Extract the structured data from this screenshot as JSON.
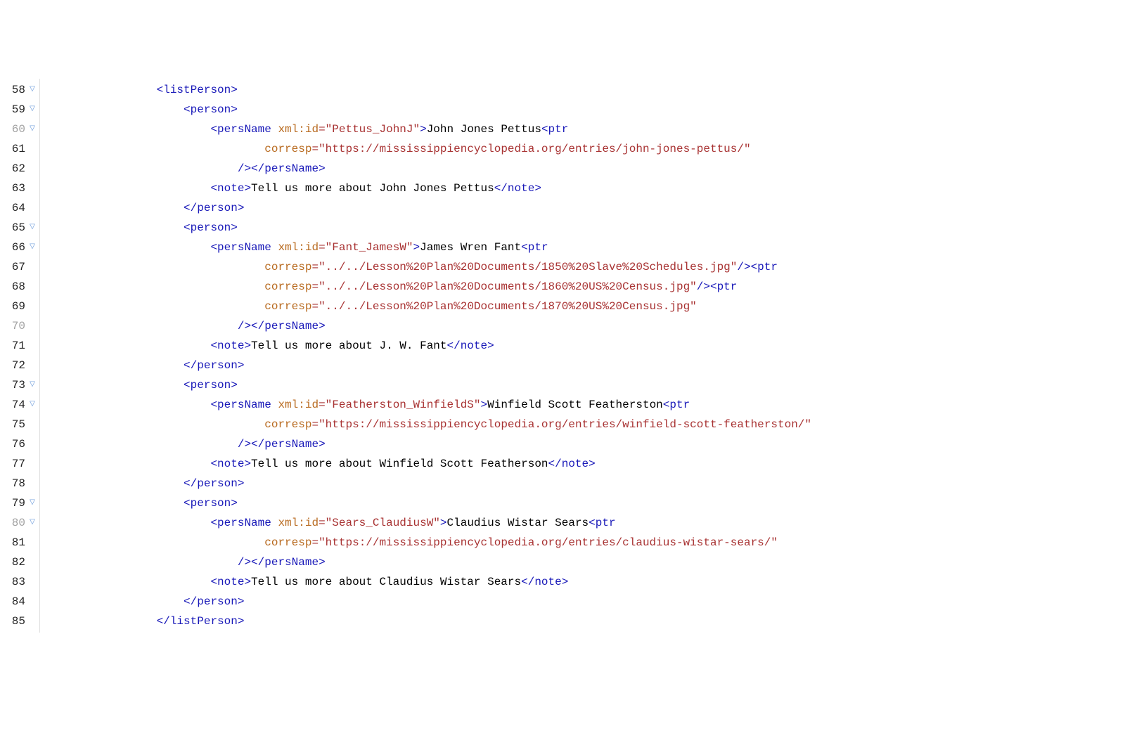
{
  "lines": [
    {
      "num": 58,
      "shade": "dark",
      "fold": true,
      "indent": 16,
      "tokens": [
        [
          "tag",
          "<listPerson>"
        ]
      ]
    },
    {
      "num": 59,
      "shade": "dark",
      "fold": true,
      "indent": 20,
      "tokens": [
        [
          "tag",
          "<person>"
        ]
      ]
    },
    {
      "num": 60,
      "shade": "light",
      "fold": true,
      "indent": 24,
      "tokens": [
        [
          "tag",
          "<persName "
        ],
        [
          "attr",
          "xml:id"
        ],
        [
          "eq",
          "="
        ],
        [
          "val",
          "\"Pettus_JohnJ\""
        ],
        [
          "tag",
          ">"
        ],
        [
          "text",
          "John Jones Pettus"
        ],
        [
          "tag",
          "<ptr"
        ]
      ]
    },
    {
      "num": 61,
      "shade": "dark",
      "fold": false,
      "indent": 32,
      "tokens": [
        [
          "attr",
          "corresp"
        ],
        [
          "eq",
          "="
        ],
        [
          "val",
          "\"https://mississippiencyclopedia.org/entries/john-jones-pettus/\""
        ]
      ]
    },
    {
      "num": 62,
      "shade": "dark",
      "fold": false,
      "indent": 28,
      "tokens": [
        [
          "tag",
          "/></persName>"
        ]
      ]
    },
    {
      "num": 63,
      "shade": "dark",
      "fold": false,
      "indent": 24,
      "tokens": [
        [
          "tag",
          "<note>"
        ],
        [
          "text",
          "Tell us more about John Jones Pettus"
        ],
        [
          "tag",
          "</note>"
        ]
      ]
    },
    {
      "num": 64,
      "shade": "dark",
      "fold": false,
      "indent": 20,
      "tokens": [
        [
          "tag",
          "</person>"
        ]
      ]
    },
    {
      "num": 65,
      "shade": "dark",
      "fold": true,
      "indent": 20,
      "tokens": [
        [
          "tag",
          "<person>"
        ]
      ]
    },
    {
      "num": 66,
      "shade": "dark",
      "fold": true,
      "indent": 24,
      "tokens": [
        [
          "tag",
          "<persName "
        ],
        [
          "attr",
          "xml:id"
        ],
        [
          "eq",
          "="
        ],
        [
          "val",
          "\"Fant_JamesW\""
        ],
        [
          "tag",
          ">"
        ],
        [
          "text",
          "James Wren Fant"
        ],
        [
          "tag",
          "<ptr"
        ]
      ]
    },
    {
      "num": 67,
      "shade": "dark",
      "fold": false,
      "indent": 32,
      "tokens": [
        [
          "attr",
          "corresp"
        ],
        [
          "eq",
          "="
        ],
        [
          "val",
          "\"../../Lesson%20Plan%20Documents/1850%20Slave%20Schedules.jpg\""
        ],
        [
          "tag",
          "/><ptr"
        ]
      ]
    },
    {
      "num": 68,
      "shade": "dark",
      "fold": false,
      "indent": 32,
      "tokens": [
        [
          "attr",
          "corresp"
        ],
        [
          "eq",
          "="
        ],
        [
          "val",
          "\"../../Lesson%20Plan%20Documents/1860%20US%20Census.jpg\""
        ],
        [
          "tag",
          "/><ptr"
        ]
      ]
    },
    {
      "num": 69,
      "shade": "dark",
      "fold": false,
      "indent": 32,
      "tokens": [
        [
          "attr",
          "corresp"
        ],
        [
          "eq",
          "="
        ],
        [
          "val",
          "\"../../Lesson%20Plan%20Documents/1870%20US%20Census.jpg\""
        ]
      ]
    },
    {
      "num": 70,
      "shade": "light",
      "fold": false,
      "indent": 28,
      "tokens": [
        [
          "tag",
          "/></persName>"
        ]
      ]
    },
    {
      "num": 71,
      "shade": "dark",
      "fold": false,
      "indent": 24,
      "tokens": [
        [
          "tag",
          "<note>"
        ],
        [
          "text",
          "Tell us more about J. W. Fant"
        ],
        [
          "tag",
          "</note>"
        ]
      ]
    },
    {
      "num": 72,
      "shade": "dark",
      "fold": false,
      "indent": 20,
      "tokens": [
        [
          "tag",
          "</person>"
        ]
      ]
    },
    {
      "num": 73,
      "shade": "dark",
      "fold": true,
      "indent": 20,
      "tokens": [
        [
          "tag",
          "<person>"
        ]
      ]
    },
    {
      "num": 74,
      "shade": "dark",
      "fold": true,
      "indent": 24,
      "tokens": [
        [
          "tag",
          "<persName "
        ],
        [
          "attr",
          "xml:id"
        ],
        [
          "eq",
          "="
        ],
        [
          "val",
          "\"Featherston_WinfieldS\""
        ],
        [
          "tag",
          ">"
        ],
        [
          "text",
          "Winfield Scott Featherston"
        ],
        [
          "tag",
          "<ptr"
        ]
      ]
    },
    {
      "num": 75,
      "shade": "dark",
      "fold": false,
      "indent": 32,
      "tokens": [
        [
          "attr",
          "corresp"
        ],
        [
          "eq",
          "="
        ],
        [
          "val",
          "\"https://mississippiencyclopedia.org/entries/winfield-scott-featherston/\""
        ]
      ]
    },
    {
      "num": 76,
      "shade": "dark",
      "fold": false,
      "indent": 28,
      "tokens": [
        [
          "tag",
          "/></persName>"
        ]
      ]
    },
    {
      "num": 77,
      "shade": "dark",
      "fold": false,
      "indent": 24,
      "tokens": [
        [
          "tag",
          "<note>"
        ],
        [
          "text",
          "Tell us more about Winfield Scott Featherson"
        ],
        [
          "tag",
          "</note>"
        ]
      ]
    },
    {
      "num": 78,
      "shade": "dark",
      "fold": false,
      "indent": 20,
      "tokens": [
        [
          "tag",
          "</person>"
        ]
      ]
    },
    {
      "num": 79,
      "shade": "dark",
      "fold": true,
      "indent": 20,
      "tokens": [
        [
          "tag",
          "<person>"
        ]
      ]
    },
    {
      "num": 80,
      "shade": "light",
      "fold": true,
      "indent": 24,
      "tokens": [
        [
          "tag",
          "<persName "
        ],
        [
          "attr",
          "xml:id"
        ],
        [
          "eq",
          "="
        ],
        [
          "val",
          "\"Sears_ClaudiusW\""
        ],
        [
          "tag",
          ">"
        ],
        [
          "text",
          "Claudius Wistar Sears"
        ],
        [
          "tag",
          "<ptr"
        ]
      ]
    },
    {
      "num": 81,
      "shade": "dark",
      "fold": false,
      "indent": 32,
      "tokens": [
        [
          "attr",
          "corresp"
        ],
        [
          "eq",
          "="
        ],
        [
          "val",
          "\"https://mississippiencyclopedia.org/entries/claudius-wistar-sears/\""
        ]
      ]
    },
    {
      "num": 82,
      "shade": "dark",
      "fold": false,
      "indent": 28,
      "tokens": [
        [
          "tag",
          "/></persName>"
        ]
      ]
    },
    {
      "num": 83,
      "shade": "dark",
      "fold": false,
      "indent": 24,
      "tokens": [
        [
          "tag",
          "<note>"
        ],
        [
          "text",
          "Tell us more about Claudius Wistar Sears"
        ],
        [
          "tag",
          "</note>"
        ]
      ]
    },
    {
      "num": 84,
      "shade": "dark",
      "fold": false,
      "indent": 20,
      "tokens": [
        [
          "tag",
          "</person>"
        ]
      ]
    },
    {
      "num": 85,
      "shade": "dark",
      "fold": false,
      "indent": 16,
      "tokens": [
        [
          "tag",
          "</listPerson>"
        ]
      ]
    }
  ],
  "fold_glyph": "▽"
}
